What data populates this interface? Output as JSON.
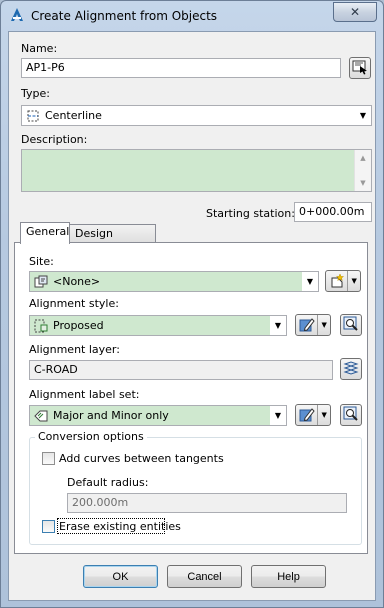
{
  "window": {
    "title": "Create Alignment from Objects",
    "close_glyph": "✕"
  },
  "name": {
    "label": "Name:",
    "value": "AP1-P6",
    "pick_icon": "pick-from-drawing-icon"
  },
  "type": {
    "label": "Type:",
    "value": "Centerline",
    "icon": "centerline-icon"
  },
  "description": {
    "label": "Description:",
    "value": ""
  },
  "starting_station": {
    "label": "Starting station:",
    "value": "0+000.00m"
  },
  "tabs": [
    {
      "label": "General",
      "active": true
    },
    {
      "label": "Design Criteria",
      "active": false
    }
  ],
  "general": {
    "site": {
      "label": "Site:",
      "value": "<None>",
      "icon": "site-icon"
    },
    "alignment_style": {
      "label": "Alignment style:",
      "value": "Proposed",
      "icon": "alignment-style-icon"
    },
    "alignment_layer": {
      "label": "Alignment layer:",
      "value": "C-ROAD",
      "icon": "layers-icon"
    },
    "alignment_label_set": {
      "label": "Alignment label set:",
      "value": "Major and Minor only",
      "icon": "label-set-icon"
    },
    "conversion_options": {
      "title": "Conversion options",
      "add_curves": {
        "label": "Add curves between tangents",
        "checked": false
      },
      "default_radius": {
        "label": "Default radius:",
        "value": "200.000m"
      },
      "erase_entities": {
        "label": "Erase existing entities",
        "checked": false
      }
    }
  },
  "buttons": {
    "ok": "OK",
    "cancel": "Cancel",
    "help": "Help"
  },
  "colors": {
    "field_green": "#cfe8cf",
    "window_frame": "#b6c9e0",
    "focus_blue": "#3c7fb1"
  }
}
